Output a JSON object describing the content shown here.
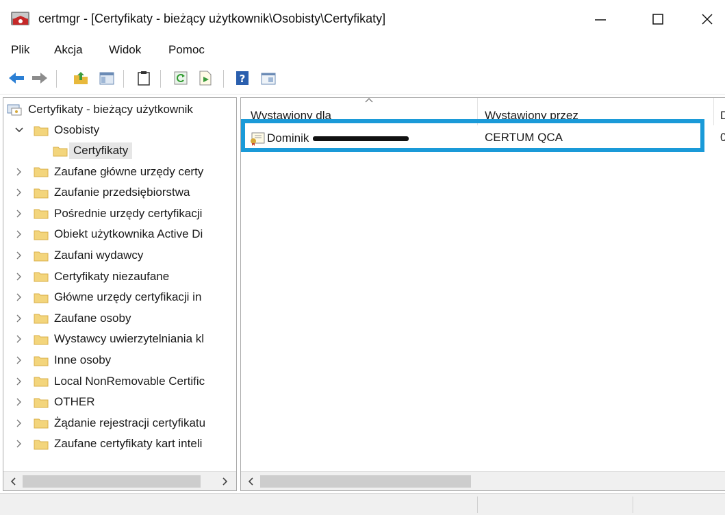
{
  "window": {
    "title": "certmgr - [Certyfikaty - bieżący użytkownik\\Osobisty\\Certyfikaty]",
    "controls": {
      "minimize": "—",
      "maximize": "☐",
      "close": "✕"
    }
  },
  "menu": {
    "items": [
      "Plik",
      "Akcja",
      "Widok",
      "Pomoc"
    ]
  },
  "toolbar": {
    "icons": [
      "back-arrow-icon",
      "forward-arrow-icon",
      "up-folder-icon",
      "show-hide-tree-icon",
      "clipboard-icon",
      "refresh-icon",
      "export-list-icon",
      "help-icon",
      "console-view-icon"
    ]
  },
  "tree": {
    "root": "Certyfikaty - bieżący użytkownik",
    "items": [
      {
        "label": "Osobisty",
        "expanded": true
      },
      {
        "label": "Certyfikaty",
        "selected": true
      },
      {
        "label": "Zaufane główne urzędy certy"
      },
      {
        "label": "Zaufanie przedsiębiorstwa"
      },
      {
        "label": "Pośrednie urzędy certyfikacji"
      },
      {
        "label": "Obiekt użytkownika Active Di"
      },
      {
        "label": "Zaufani wydawcy"
      },
      {
        "label": "Certyfikaty niezaufane"
      },
      {
        "label": "Główne urzędy certyfikacji in"
      },
      {
        "label": "Zaufane osoby"
      },
      {
        "label": "Wystawcy uwierzytelniania kl"
      },
      {
        "label": "Inne osoby"
      },
      {
        "label": "Local NonRemovable Certific"
      },
      {
        "label": "OTHER"
      },
      {
        "label": "Żądanie rejestracji certyfikatu"
      },
      {
        "label": "Zaufane certyfikaty kart inteli"
      }
    ]
  },
  "list": {
    "columns": [
      "Wystawiony dla",
      "Wystawiony przez",
      "D"
    ],
    "rows": [
      {
        "issued_to": "Dominik",
        "issued_by": "CERTUM QCA",
        "date": "0"
      }
    ]
  },
  "colors": {
    "highlight": "#1a9ad8",
    "folder": "#f3d57c",
    "selection": "#e6e6e6"
  }
}
